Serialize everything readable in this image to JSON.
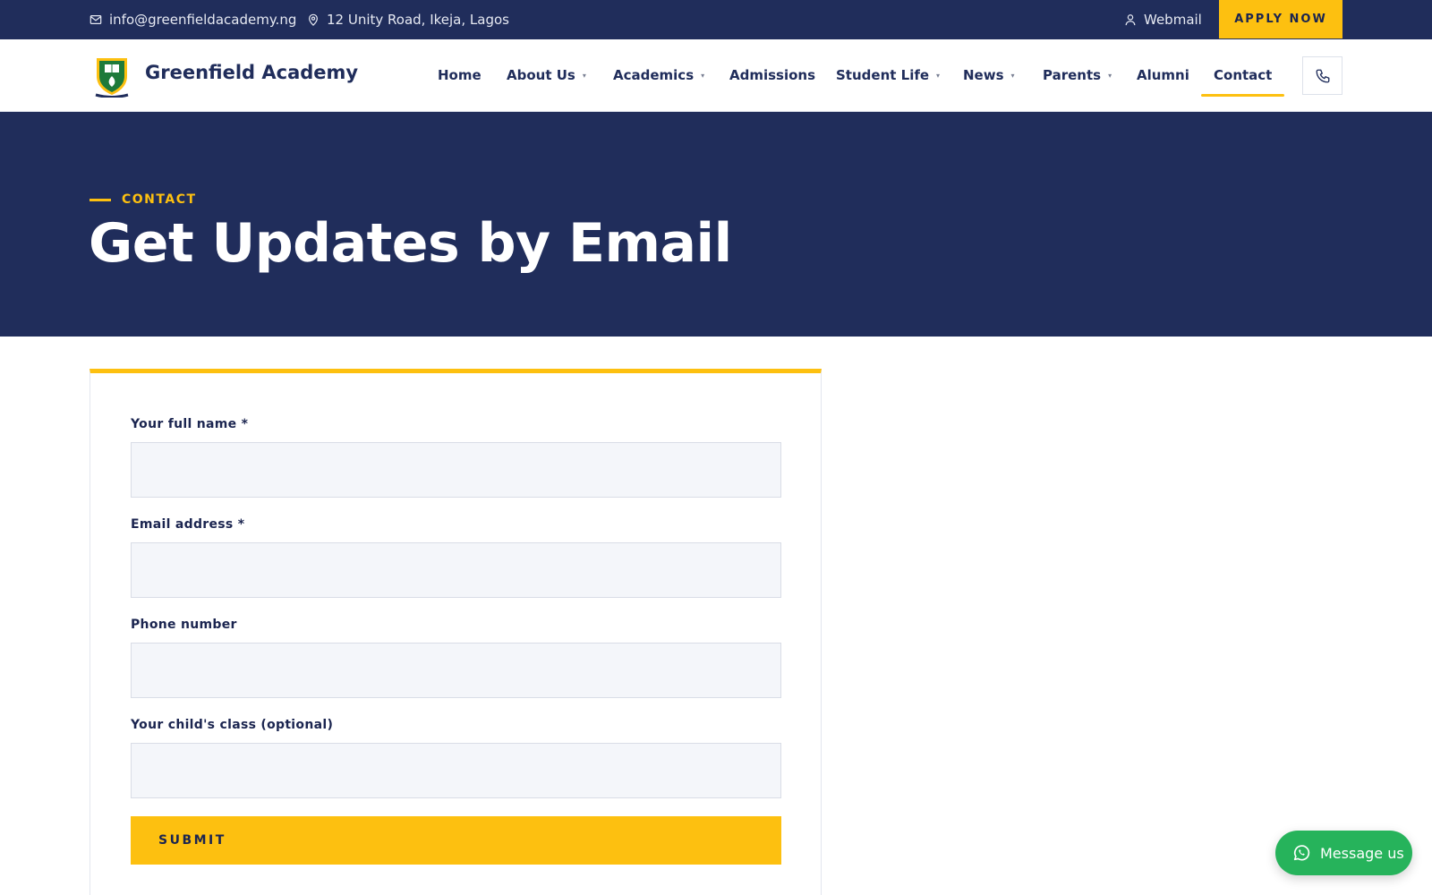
{
  "topbar": {
    "email": "info@greenfieldacademy.ng",
    "address": "12 Unity Road, Ikeja, Lagos",
    "webmail": "Webmail",
    "apply": "APPLY NOW",
    "icons": {
      "email": "mail-icon",
      "address": "map-pin-icon",
      "webmail": "user-icon"
    }
  },
  "nav": {
    "brand": "Greenfield Academy",
    "items": [
      {
        "label": "Home",
        "dropdown": false
      },
      {
        "label": "About Us",
        "dropdown": true
      },
      {
        "label": "Academics",
        "dropdown": true
      },
      {
        "label": "Admissions",
        "dropdown": false
      },
      {
        "label": "Student Life",
        "dropdown": true
      },
      {
        "label": "News",
        "dropdown": true
      },
      {
        "label": "Parents",
        "dropdown": true
      },
      {
        "label": "Alumni",
        "dropdown": false
      },
      {
        "label": "Contact",
        "dropdown": false,
        "active": true
      }
    ],
    "caret": "▾",
    "phone_icon": "phone-icon"
  },
  "hero": {
    "eyebrow": "CONTACT",
    "title": "Get Updates by Email"
  },
  "form": {
    "fields": [
      {
        "label": "Your full name *",
        "value": ""
      },
      {
        "label": "Email address *",
        "value": ""
      },
      {
        "label": "Phone number",
        "value": ""
      },
      {
        "label": "Your child's class (optional)",
        "value": ""
      }
    ],
    "submit": "SUBMIT"
  },
  "floating": {
    "message": "Message us",
    "icon": "whatsapp-icon"
  },
  "colors": {
    "navy": "#202d5b",
    "accent": "#fdc010",
    "whatsapp": "#26b35b"
  }
}
